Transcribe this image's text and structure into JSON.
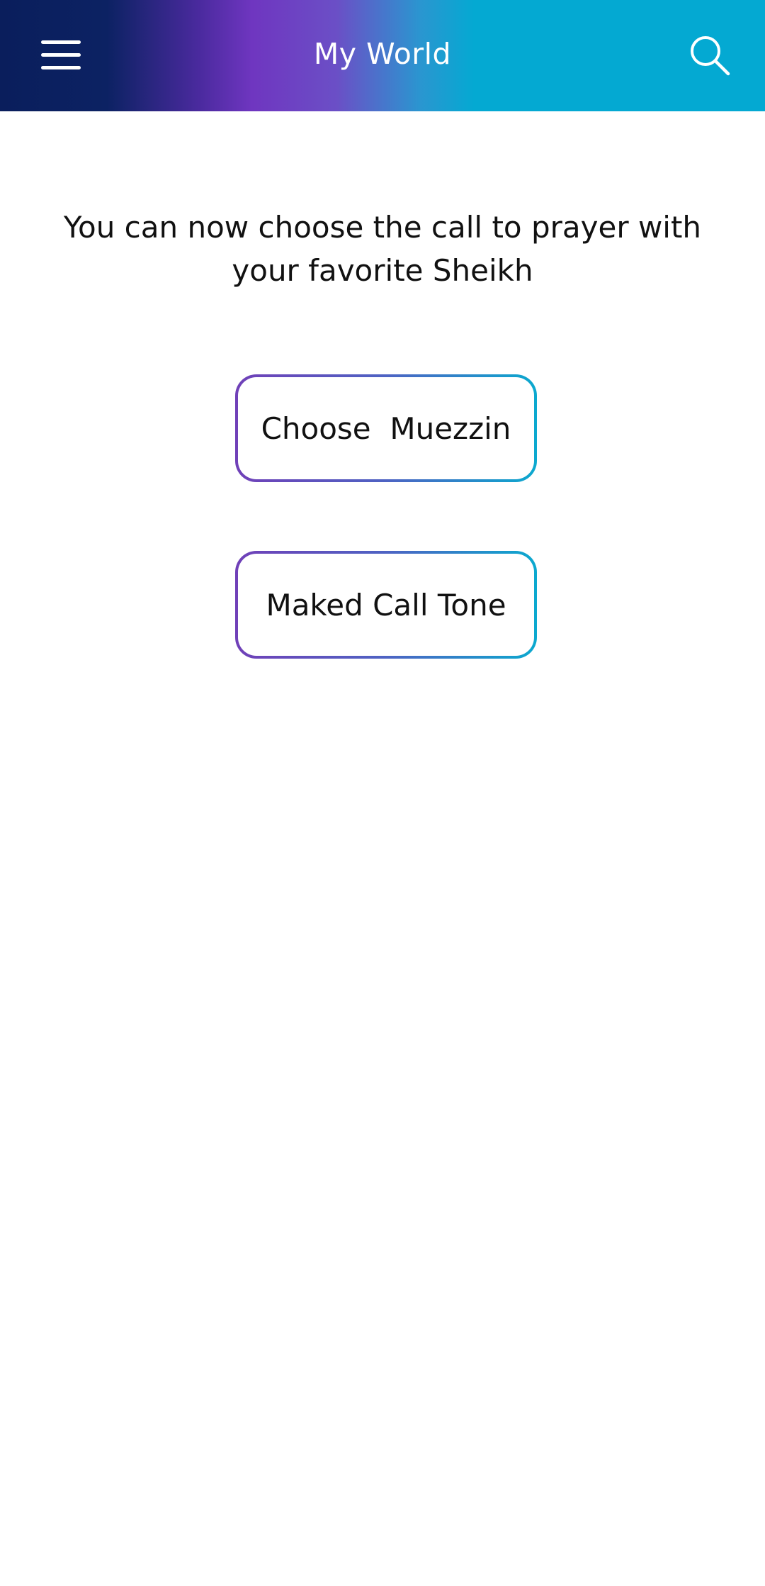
{
  "header": {
    "title": "My World",
    "menu_icon": "hamburger-menu-icon",
    "search_icon": "search-icon",
    "gradient_colors": [
      "#0a1e5c",
      "#6f36c0",
      "#04a9d2"
    ]
  },
  "main": {
    "intro_text": "You can now choose the call to prayer with your favorite Sheikh",
    "buttons": [
      {
        "label": "Choose  Muezzin"
      },
      {
        "label": "Maked Call Tone"
      }
    ],
    "button_border_colors": [
      "#7040b8",
      "#0ba9cf"
    ]
  }
}
